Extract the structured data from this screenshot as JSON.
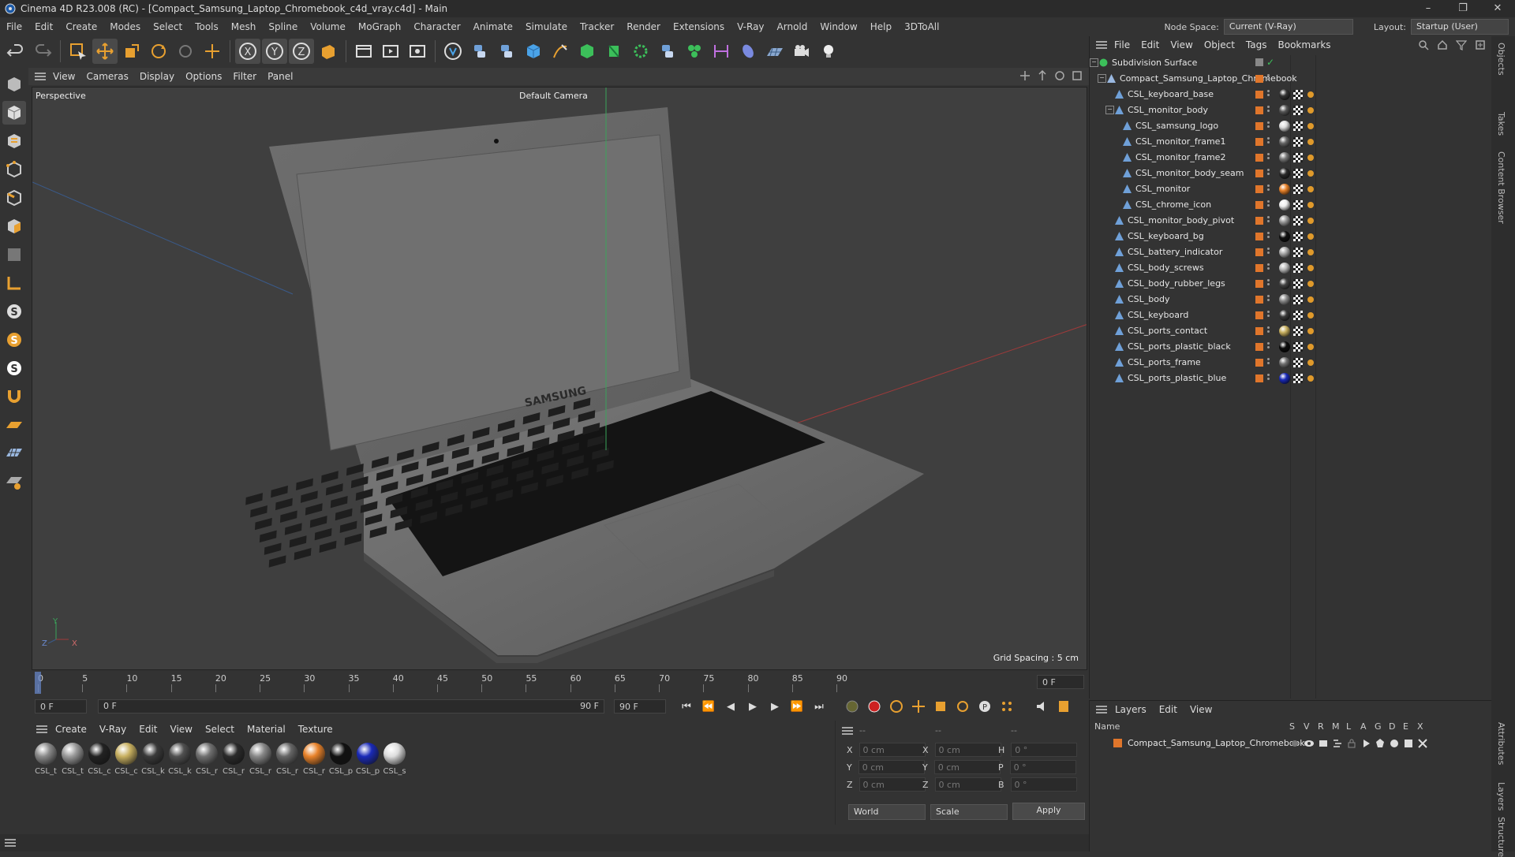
{
  "window": {
    "title": "Cinema 4D R23.008 (RC) - [Compact_Samsung_Laptop_Chromebook_c4d_vray.c4d] - Main",
    "controls": [
      "–",
      "❐",
      "✕"
    ]
  },
  "menubar": {
    "items": [
      "File",
      "Edit",
      "Create",
      "Modes",
      "Select",
      "Tools",
      "Mesh",
      "Spline",
      "Volume",
      "MoGraph",
      "Character",
      "Animate",
      "Simulate",
      "Tracker",
      "Render",
      "Extensions",
      "V-Ray",
      "Arnold",
      "Window",
      "Help",
      "3DToAll"
    ],
    "node_space_label": "Node Space:",
    "node_space_value": "Current (V-Ray)",
    "layout_label": "Layout:",
    "layout_value": "Startup (User)"
  },
  "viewport": {
    "menu": [
      "View",
      "Cameras",
      "Display",
      "Options",
      "Filter",
      "Panel"
    ],
    "name": "Perspective",
    "camera": "Default Camera",
    "grid_spacing": "Grid Spacing : 5 cm",
    "brand_text": "SAMSUNG",
    "axes": [
      "Y",
      "Z",
      "X"
    ]
  },
  "timeline": {
    "ticks": [
      "0",
      "5",
      "10",
      "15",
      "20",
      "25",
      "30",
      "35",
      "40",
      "45",
      "50",
      "55",
      "60",
      "65",
      "70",
      "75",
      "80",
      "85",
      "90"
    ],
    "current_frame": "0 F",
    "start_field": "0 F",
    "range_start": "0 F",
    "range_end": "90 F",
    "end_field": "90 F"
  },
  "material_bar": {
    "menu": [
      "Create",
      "V-Ray",
      "Edit",
      "View",
      "Select",
      "Material",
      "Texture"
    ],
    "materials": [
      {
        "label": "CSL_t",
        "color": "#8a8a8a"
      },
      {
        "label": "CSL_t",
        "color": "#9a9a9a"
      },
      {
        "label": "CSL_c",
        "color": "#222222"
      },
      {
        "label": "CSL_c",
        "color": "#c8b060"
      },
      {
        "label": "CSL_k",
        "color": "#3a3a3a"
      },
      {
        "label": "CSL_k",
        "color": "#505050"
      },
      {
        "label": "CSL_r",
        "color": "#707070"
      },
      {
        "label": "CSL_r",
        "color": "#2a2a2a"
      },
      {
        "label": "CSL_r",
        "color": "#888888"
      },
      {
        "label": "CSL_r",
        "color": "#666666"
      },
      {
        "label": "CSL_r",
        "color": "#e8822a"
      },
      {
        "label": "CSL_p",
        "color": "#111111"
      },
      {
        "label": "CSL_p",
        "color": "#1a2ab8"
      },
      {
        "label": "CSL_s",
        "color": "#dddddd"
      }
    ]
  },
  "coordinates": {
    "headers": [
      "--",
      "--",
      "--"
    ],
    "rows": [
      {
        "a": "X",
        "av": "0 cm",
        "b": "X",
        "bv": "0 cm",
        "c": "H",
        "cv": "0 °"
      },
      {
        "a": "Y",
        "av": "0 cm",
        "b": "Y",
        "bv": "0 cm",
        "c": "P",
        "cv": "0 °"
      },
      {
        "a": "Z",
        "av": "0 cm",
        "b": "Z",
        "bv": "0 cm",
        "c": "B",
        "cv": "0 °"
      }
    ],
    "mode": "World",
    "scale": "Scale",
    "apply": "Apply"
  },
  "object_manager": {
    "menu": [
      "File",
      "Edit",
      "View",
      "Object",
      "Tags",
      "Bookmarks"
    ],
    "objects": [
      {
        "name": "Subdivision Surface",
        "depth": 0,
        "material": "",
        "special": "subdiv"
      },
      {
        "name": "Compact_Samsung_Laptop_Chromebook",
        "depth": 1,
        "material": ""
      },
      {
        "name": "CSL_keyboard_base",
        "depth": 2,
        "material": "#333333"
      },
      {
        "name": "CSL_monitor_body",
        "depth": 2,
        "material": "#555555"
      },
      {
        "name": "CSL_samsung_logo",
        "depth": 3,
        "material": "#dddddd"
      },
      {
        "name": "CSL_monitor_frame1",
        "depth": 3,
        "material": "#666666"
      },
      {
        "name": "CSL_monitor_frame2",
        "depth": 3,
        "material": "#777777"
      },
      {
        "name": "CSL_monitor_body_seam",
        "depth": 3,
        "material": "#2a2a2a"
      },
      {
        "name": "CSL_monitor",
        "depth": 3,
        "material": "#e8822a"
      },
      {
        "name": "CSL_chrome_icon",
        "depth": 3,
        "material": "#eeeeee"
      },
      {
        "name": "CSL_monitor_body_pivot",
        "depth": 2,
        "material": "#999999"
      },
      {
        "name": "CSL_keyboard_bg",
        "depth": 2,
        "material": "#111111"
      },
      {
        "name": "CSL_battery_indicator",
        "depth": 2,
        "material": "#aaaaaa"
      },
      {
        "name": "CSL_body_screws",
        "depth": 2,
        "material": "#bbbbbb"
      },
      {
        "name": "CSL_body_rubber_legs",
        "depth": 2,
        "material": "#444444"
      },
      {
        "name": "CSL_body",
        "depth": 2,
        "material": "#8a8a8a"
      },
      {
        "name": "CSL_keyboard",
        "depth": 2,
        "material": "#3a3a3a"
      },
      {
        "name": "CSL_ports_contact",
        "depth": 2,
        "material": "#c8b060"
      },
      {
        "name": "CSL_ports_plastic_black",
        "depth": 2,
        "material": "#0c0c0c"
      },
      {
        "name": "CSL_ports_frame",
        "depth": 2,
        "material": "#707070"
      },
      {
        "name": "CSL_ports_plastic_blue",
        "depth": 2,
        "material": "#1a2ab8"
      }
    ]
  },
  "layers_panel": {
    "menu": [
      "Layers",
      "Edit",
      "View"
    ],
    "columns": [
      "Name",
      "S",
      "V",
      "R",
      "M",
      "L",
      "A",
      "G",
      "D",
      "E",
      "X"
    ],
    "layer_name": "Compact_Samsung_Laptop_Chromebook",
    "layer_color": "#e0762b"
  },
  "side_tabs": [
    "Objects",
    "Takes",
    "Content Browser",
    "Attributes",
    "Layers",
    "Structure"
  ]
}
